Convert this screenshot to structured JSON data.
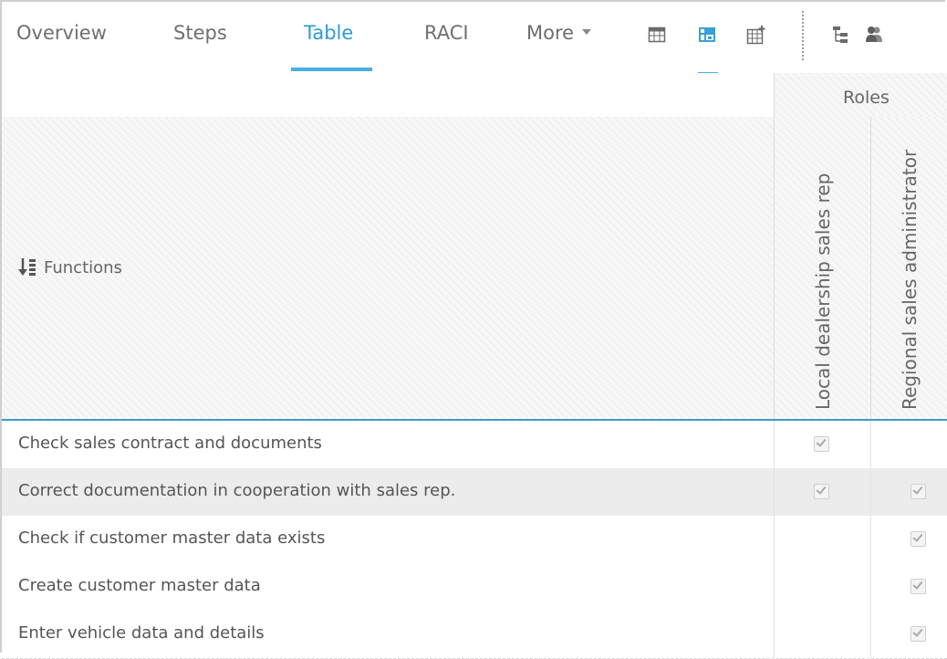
{
  "tabs": [
    {
      "label": "Overview",
      "active": false
    },
    {
      "label": "Steps",
      "active": false
    },
    {
      "label": "Table",
      "active": true
    },
    {
      "label": "RACI",
      "active": false
    },
    {
      "label": "More",
      "active": false
    }
  ],
  "toolbar": {
    "icons": [
      "table-view-icon",
      "table-detail-view-icon",
      "table-add-icon",
      "hierarchy-icon",
      "roles-icon"
    ],
    "active_icon": "table-detail-view-icon"
  },
  "header": {
    "group_label": "Roles",
    "functions_label": "Functions",
    "roles": [
      "Local dealership sales rep",
      "Regional sales administrator"
    ]
  },
  "rows": [
    {
      "label": "Check sales contract and documents",
      "checks": [
        true,
        false
      ],
      "selected": false
    },
    {
      "label": "Correct documentation in cooperation with sales rep.",
      "checks": [
        true,
        true
      ],
      "selected": true
    },
    {
      "label": "Check if customer master data exists",
      "checks": [
        false,
        true
      ],
      "selected": false
    },
    {
      "label": "Create customer master data",
      "checks": [
        false,
        true
      ],
      "selected": false
    },
    {
      "label": "Enter vehicle data and details",
      "checks": [
        false,
        true
      ],
      "selected": false
    }
  ],
  "colors": {
    "accent": "#2d9bd3",
    "text": "#555555",
    "selected_row": "#ececec"
  }
}
